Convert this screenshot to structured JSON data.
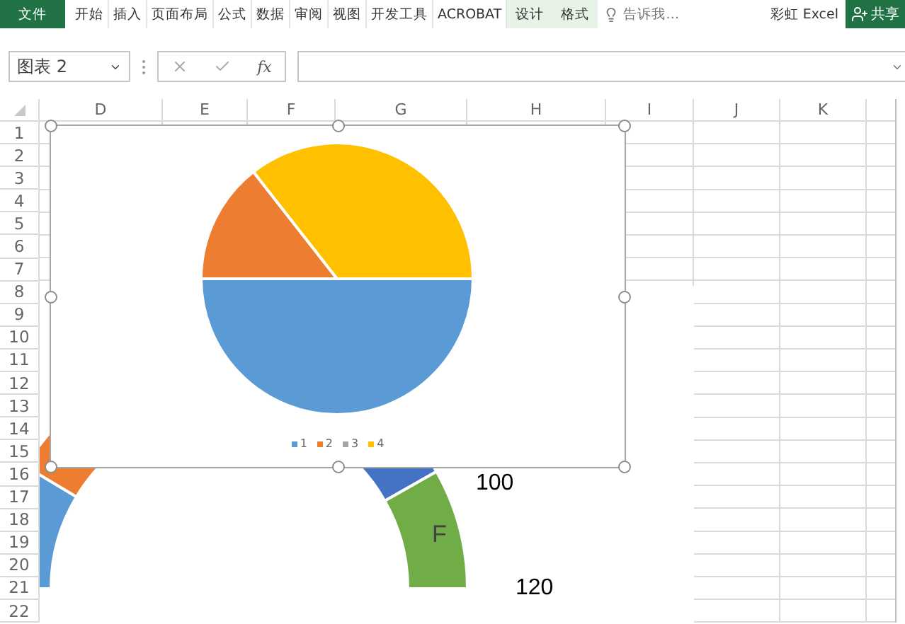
{
  "ribbon": {
    "tabs": [
      {
        "label": "文件",
        "kind": "file",
        "selected": false
      },
      {
        "label": "开始",
        "kind": "normal",
        "selected": false
      },
      {
        "label": "插入",
        "kind": "normal",
        "selected": false
      },
      {
        "label": "页面布局",
        "kind": "normal",
        "selected": false
      },
      {
        "label": "公式",
        "kind": "normal",
        "selected": false
      },
      {
        "label": "数据",
        "kind": "normal",
        "selected": false
      },
      {
        "label": "审阅",
        "kind": "normal",
        "selected": false
      },
      {
        "label": "视图",
        "kind": "normal",
        "selected": false
      },
      {
        "label": "开发工具",
        "kind": "normal",
        "selected": false
      },
      {
        "label": "ACROBAT",
        "kind": "normal",
        "selected": false
      },
      {
        "label": "设计",
        "kind": "contextual",
        "selected": false
      },
      {
        "label": "格式",
        "kind": "contextual",
        "selected": false
      }
    ],
    "tell_me": "告诉我…",
    "user": "彩虹 Excel",
    "share": "共享"
  },
  "formula_bar": {
    "name_box": "图表 2",
    "function_label": "fx"
  },
  "sheet": {
    "columns": [
      "D",
      "E",
      "F",
      "G",
      "H",
      "I",
      "J",
      "K"
    ],
    "rows": [
      "1",
      "2",
      "3",
      "4",
      "5",
      "6",
      "7",
      "8",
      "9",
      "10",
      "11",
      "12",
      "13",
      "14",
      "15",
      "16",
      "17",
      "18",
      "19",
      "20",
      "21",
      "22"
    ]
  },
  "chart": {
    "legend": [
      {
        "label": "1",
        "color": "#5b9bd5"
      },
      {
        "label": "2",
        "color": "#ed7d31"
      },
      {
        "label": "3",
        "color": "#a5a5a5"
      },
      {
        "label": "4",
        "color": "#ffc000"
      }
    ]
  },
  "background_chart": {
    "labels": [
      "F",
      "100",
      "120"
    ]
  }
}
